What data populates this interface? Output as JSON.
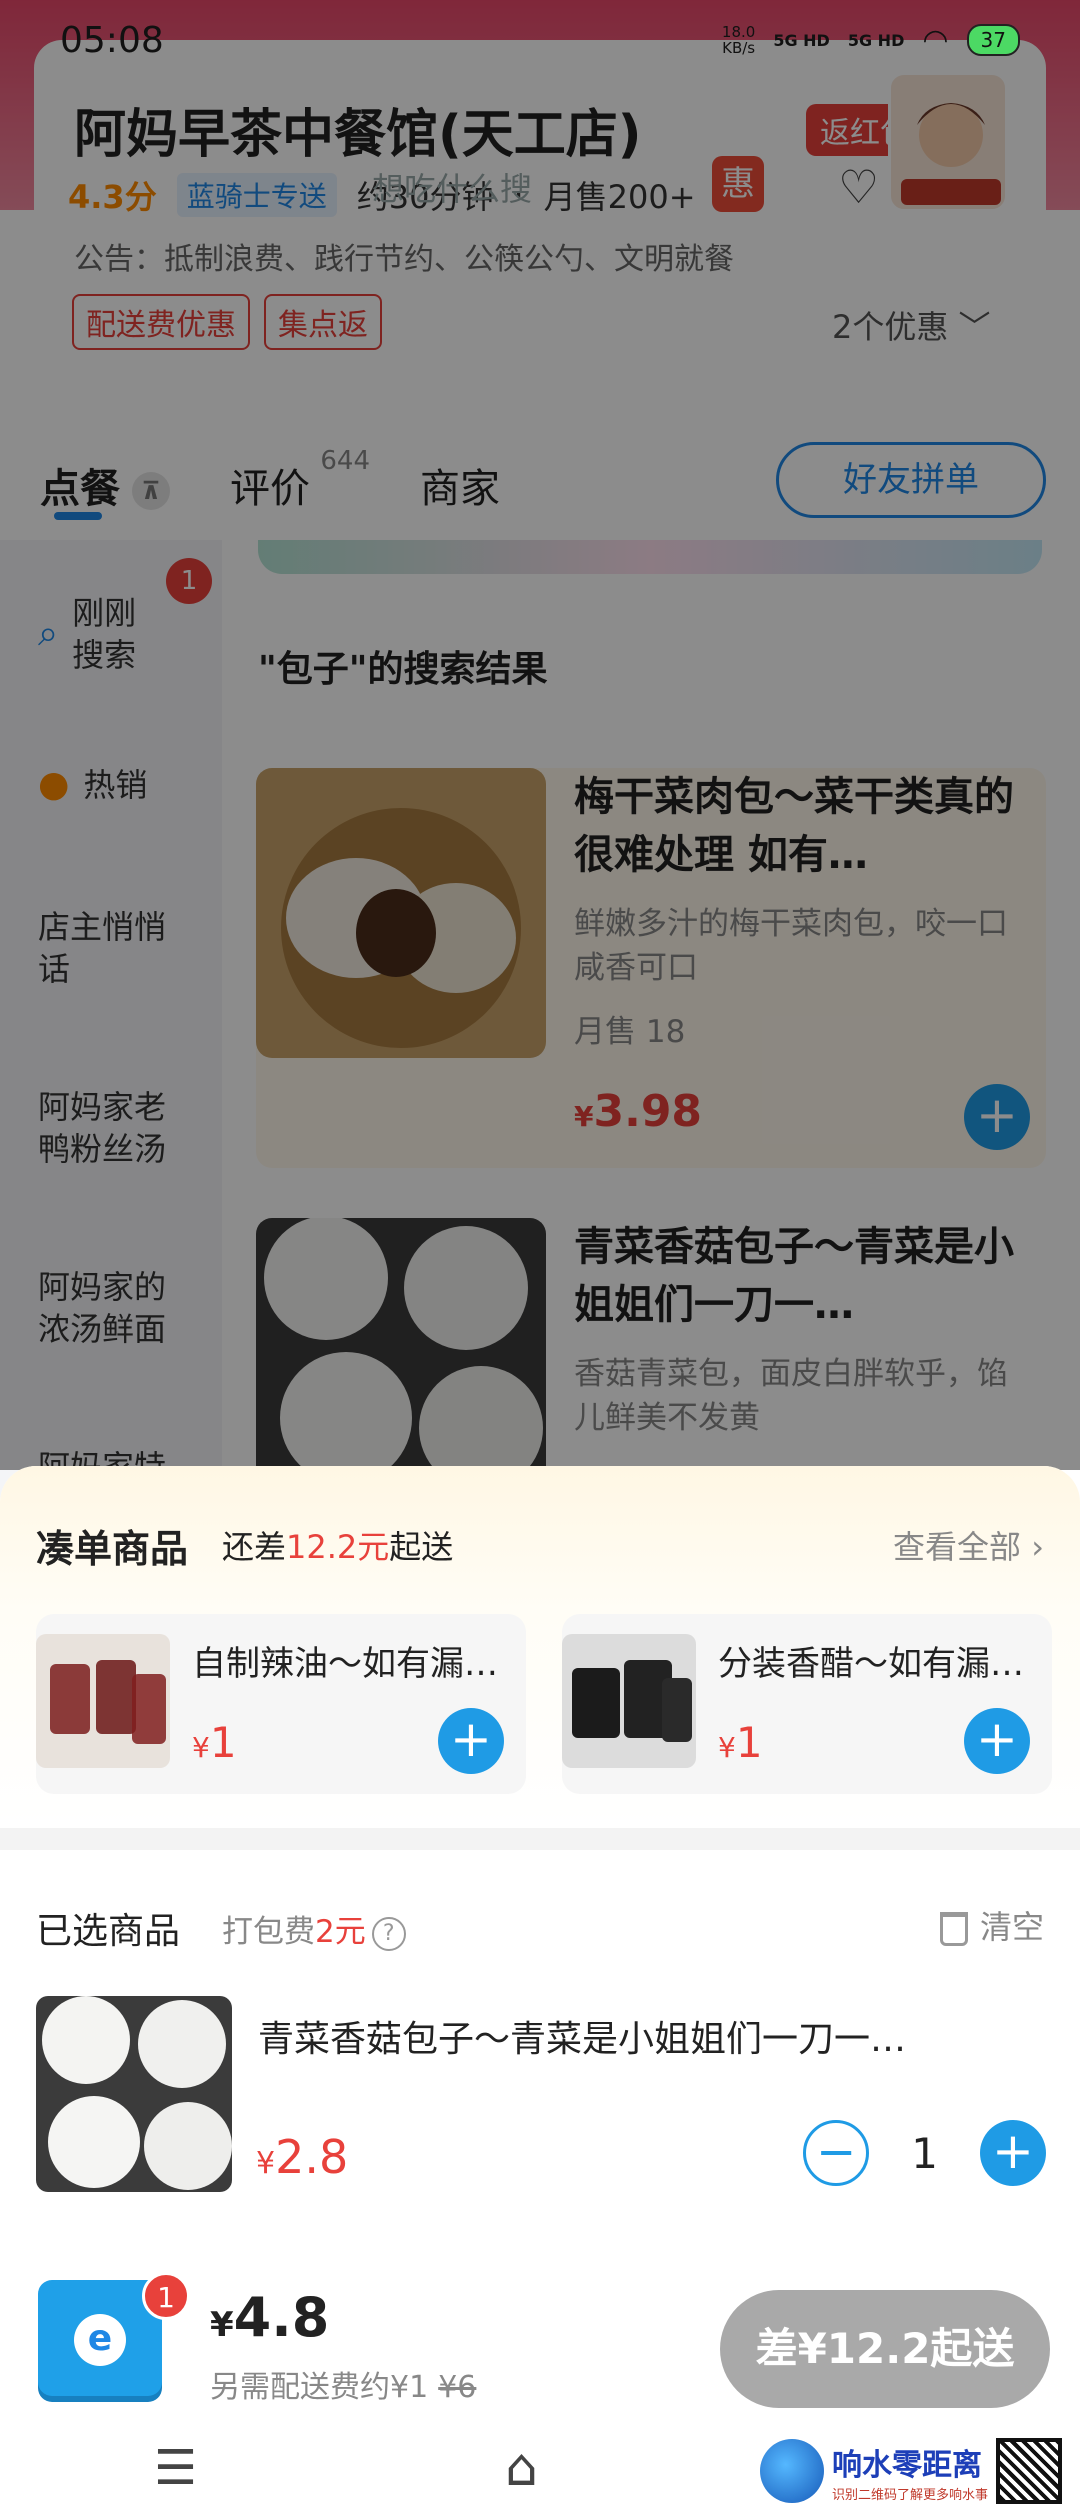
{
  "status_bar": {
    "time": "05:08",
    "net_speed": "18.0\nKB/s",
    "signal1": "5G HD",
    "signal2": "5G HD",
    "battery": "37"
  },
  "shop": {
    "name": "阿妈早茶中餐馆(天工店)",
    "rebate": "返红包",
    "score": "4.3分",
    "delivery_tag": "蓝骑士专送",
    "eta": "约30分钟",
    "monthly_sales": "月售200+",
    "search_hint": "想吃什么搜",
    "hui": "惠",
    "notice": "公告：抵制浪费、践行节约、公筷公勺、文明就餐",
    "promo_tags": [
      "配送费优惠",
      "集点返"
    ],
    "promo_count": "2个优惠 ﹀"
  },
  "tabs": [
    {
      "label": "点餐",
      "pin": "⊼"
    },
    {
      "label": "评价",
      "count": "644"
    },
    {
      "label": "商家"
    }
  ],
  "friend_button": "好友拼单",
  "sidebar": {
    "items": [
      "刚刚\n搜索",
      "热销",
      "店主悄悄\n话",
      "阿妈家老\n鸭粉丝汤",
      "阿妈家的\n浓汤鲜面",
      "阿妈家特"
    ],
    "badge": "1"
  },
  "results": {
    "title": "\"包子\"的搜索结果",
    "products": [
      {
        "name": "梅干菜肉包～菜干类真的很难处理 如有…",
        "desc": "鲜嫩多汁的梅干菜肉包，咬一口咸香可口",
        "sales": "月售 18",
        "currency": "¥",
        "price": "3.98"
      },
      {
        "name": "青菜香菇包子～青菜是小姐姐们一刀一…",
        "desc": "香菇青菜包，面皮白胖软乎，馅儿鲜美不发黄"
      }
    ]
  },
  "combo": {
    "title": "凑单商品",
    "sub_prefix": "还差",
    "sub_amount": "12.2元",
    "sub_suffix": "起送",
    "view_all": "查看全部 ›",
    "items": [
      {
        "name": "自制辣油～如有漏油、...",
        "currency": "¥",
        "price": "1"
      },
      {
        "name": "分装香醋～如有漏油、...",
        "currency": "¥",
        "price": "1"
      }
    ]
  },
  "selected": {
    "title": "已选商品",
    "fee_label": "打包费",
    "fee_amount": "2元",
    "help": "?",
    "clear": "清空",
    "item": {
      "name": "青菜香菇包子～青菜是小姐姐们一刀一…",
      "currency": "¥",
      "price": "2.8",
      "qty": "1"
    }
  },
  "cart": {
    "badge": "1",
    "currency": "¥",
    "total": "4.8",
    "delivery_note": "另需配送费约¥1",
    "delivery_original": "¥6",
    "checkout": "差¥12.2起送"
  },
  "nav": {
    "menu": "☰",
    "home": "⌂"
  },
  "watermark": {
    "title": "响水零距离",
    "subtitle": "识别二维码了解更多响水事"
  },
  "colors": {
    "accent_blue": "#1f9be5",
    "price_red": "#e8413b",
    "header_pink": "#e9486a",
    "disabled_gray": "#a9a9a9"
  }
}
